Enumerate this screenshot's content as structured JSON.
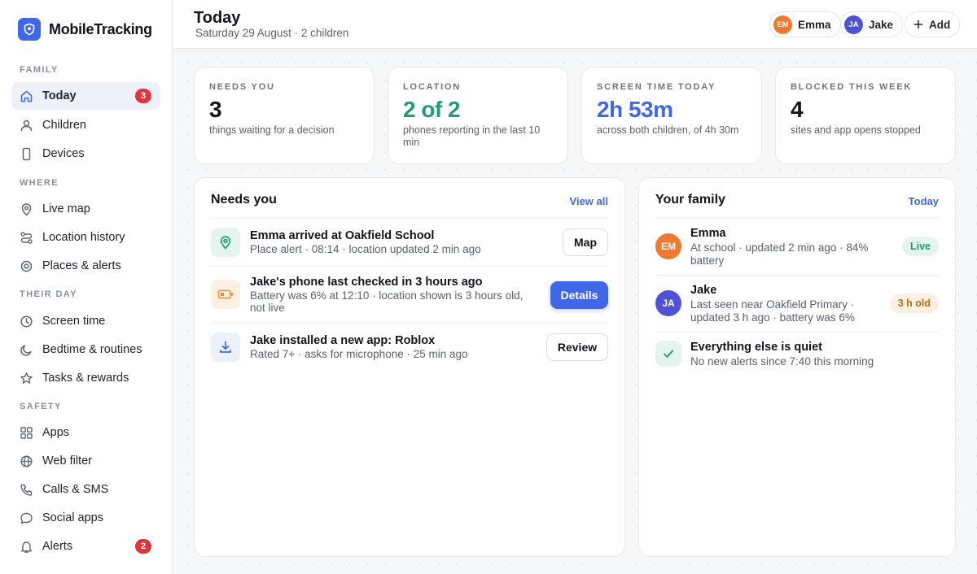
{
  "brand": {
    "name": "MobileTracking"
  },
  "sidebar": {
    "sections": [
      {
        "title": "FAMILY"
      },
      {
        "title": "WHERE"
      },
      {
        "title": "THEIR DAY"
      },
      {
        "title": "SAFETY"
      }
    ],
    "items": [
      {
        "label": "Today",
        "icon": "home-icon",
        "badge": "3",
        "active": true
      },
      {
        "label": "Children",
        "icon": "person-icon"
      },
      {
        "label": "Devices",
        "icon": "phone-icon"
      },
      {
        "label": "Live map",
        "icon": "location-pin-icon"
      },
      {
        "label": "Location history",
        "icon": "route-icon"
      },
      {
        "label": "Places & alerts",
        "icon": "target-icon"
      },
      {
        "label": "Screen time",
        "icon": "clock-icon"
      },
      {
        "label": "Bedtime & routines",
        "icon": "moon-icon"
      },
      {
        "label": "Tasks & rewards",
        "icon": "star-icon"
      },
      {
        "label": "Apps",
        "icon": "grid-icon"
      },
      {
        "label": "Web filter",
        "icon": "globe-icon"
      },
      {
        "label": "Calls & SMS",
        "icon": "phone-call-icon"
      },
      {
        "label": "Social apps",
        "icon": "chat-bubble-icon"
      },
      {
        "label": "Alerts",
        "icon": "bell-icon",
        "badge": "2"
      }
    ]
  },
  "header": {
    "title": "Today",
    "subtitle": "Saturday 29 August · 2 children",
    "children": [
      {
        "initials": "EM",
        "name": "Emma",
        "color": "#ef7a2f"
      },
      {
        "initials": "JA",
        "name": "Jake",
        "color": "#4f52d6"
      }
    ],
    "add_label": "Add"
  },
  "stats": [
    {
      "label": "NEEDS YOU",
      "value": "3",
      "desc": "things waiting for a decision",
      "color": "#12141a"
    },
    {
      "label": "LOCATION",
      "value": "2 of 2",
      "desc": "phones reporting in the last 10 min",
      "color": "#1f9d76"
    },
    {
      "label": "SCREEN TIME TODAY",
      "value": "2h 53m",
      "desc": "across both children, of 4h 30m",
      "color": "#3f67e8"
    },
    {
      "label": "BLOCKED THIS WEEK",
      "value": "4",
      "desc": "sites and app opens stopped",
      "color": "#12141a"
    }
  ],
  "needs": {
    "title": "Needs you",
    "link": "View all",
    "items": [
      {
        "title": "Emma arrived at Oakfield School",
        "sub": "Place alert · 08:14 · location updated 2 min ago",
        "button": "Map",
        "icon": "location-pin-icon"
      },
      {
        "title": "Jake's phone last checked in 3 hours ago",
        "sub": "Battery was 6% at 12:10 · location shown is 3 hours old, not live",
        "button": "Details",
        "icon": "battery-low-icon"
      },
      {
        "title": "Jake installed a new app: Roblox",
        "sub": "Rated 7+ · asks for microphone · 25 min ago",
        "button": "Review",
        "icon": "download-icon"
      }
    ]
  },
  "family": {
    "title": "Your family",
    "link": "Today",
    "members": [
      {
        "initials": "EM",
        "name": "Emma",
        "sub": "At school · updated 2 min ago · 84% battery",
        "status": "Live",
        "color": "#ef7a2f"
      },
      {
        "initials": "JA",
        "name": "Jake",
        "sub": "Last seen near Oakfield Primary · updated 3 h ago · battery was 6%",
        "status": "3 h old",
        "color": "#4f52d6"
      }
    ],
    "quiet": {
      "title": "Everything else is quiet",
      "sub": "No new alerts since 7:40 this morning",
      "icon": "checkmark-icon"
    }
  }
}
